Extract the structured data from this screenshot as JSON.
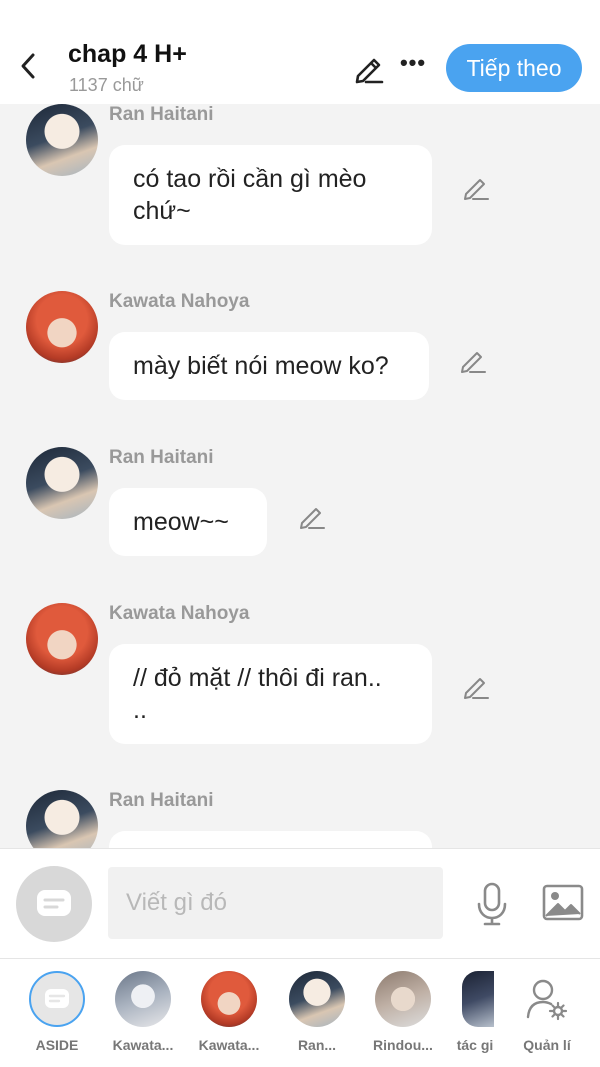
{
  "header": {
    "title": "chap 4 H+",
    "word_count": "1137 chữ",
    "next_label": "Tiếp theo"
  },
  "messages": [
    {
      "sender": "Ran Haitani",
      "text_line1": "có tao rồi cần gì mèo",
      "text_line2": "chứ~"
    },
    {
      "sender": "Kawata Nahoya",
      "text": "mày biết nói meow ko?"
    },
    {
      "sender": "Ran Haitani",
      "text": "meow~~"
    },
    {
      "sender": "Kawata Nahoya",
      "text_line1": "// đỏ mặt // thôi đi ran..",
      "text_line2": ".."
    },
    {
      "sender": "Ran Haitani",
      "text": ""
    }
  ],
  "composer": {
    "placeholder": "Viết gì đó"
  },
  "characters": [
    {
      "label": "ASIDE"
    },
    {
      "label": "Kawata..."
    },
    {
      "label": "Kawata..."
    },
    {
      "label": "Ran..."
    },
    {
      "label": "Rindou..."
    },
    {
      "label": "tác gi"
    },
    {
      "label": "Quản lí"
    }
  ],
  "colors": {
    "accent": "#4aa3f0",
    "background": "#f3f3f3",
    "sender_gray": "#999999"
  },
  "icons": {
    "back": "chevron-left-icon",
    "edit": "pencil-icon",
    "more": "more-dots-icon",
    "aside": "chat-bubble-icon",
    "mic": "microphone-icon",
    "image": "image-icon",
    "manage": "user-settings-icon"
  }
}
